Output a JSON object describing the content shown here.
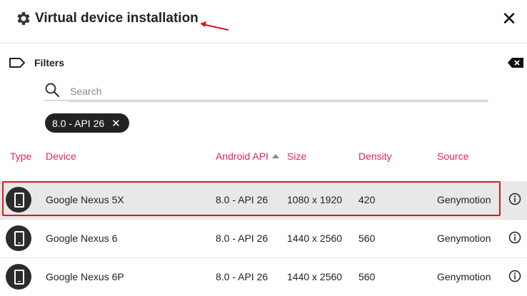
{
  "dialog": {
    "title": "Virtual device installation",
    "title_icon": "gear-icon",
    "close_glyph": "✕"
  },
  "filters": {
    "label": "Filters",
    "search_placeholder": "Search",
    "search_value": "",
    "chips": [
      {
        "label": "8.0 - API 26",
        "remove_glyph": "✕"
      }
    ]
  },
  "table": {
    "columns": {
      "type": "Type",
      "device": "Device",
      "api": "Android API",
      "size": "Size",
      "density": "Density",
      "source": "Source"
    },
    "sorted_by": "api",
    "rows": [
      {
        "device": "Google Nexus 5X",
        "api": "8.0 - API 26",
        "size": "1080 x 1920",
        "density": "420",
        "source": "Genymotion",
        "selected": true
      },
      {
        "device": "Google Nexus 6",
        "api": "8.0 - API 26",
        "size": "1440 x 2560",
        "density": "560",
        "source": "Genymotion",
        "selected": false
      },
      {
        "device": "Google Nexus 6P",
        "api": "8.0 - API 26",
        "size": "1440 x 2560",
        "density": "560",
        "source": "Genymotion",
        "selected": false
      }
    ]
  },
  "colors": {
    "header_accent": "#e91e63",
    "annotation": "#e01616",
    "selected_row": "#e8e8e8",
    "chip_bg": "#222222"
  }
}
